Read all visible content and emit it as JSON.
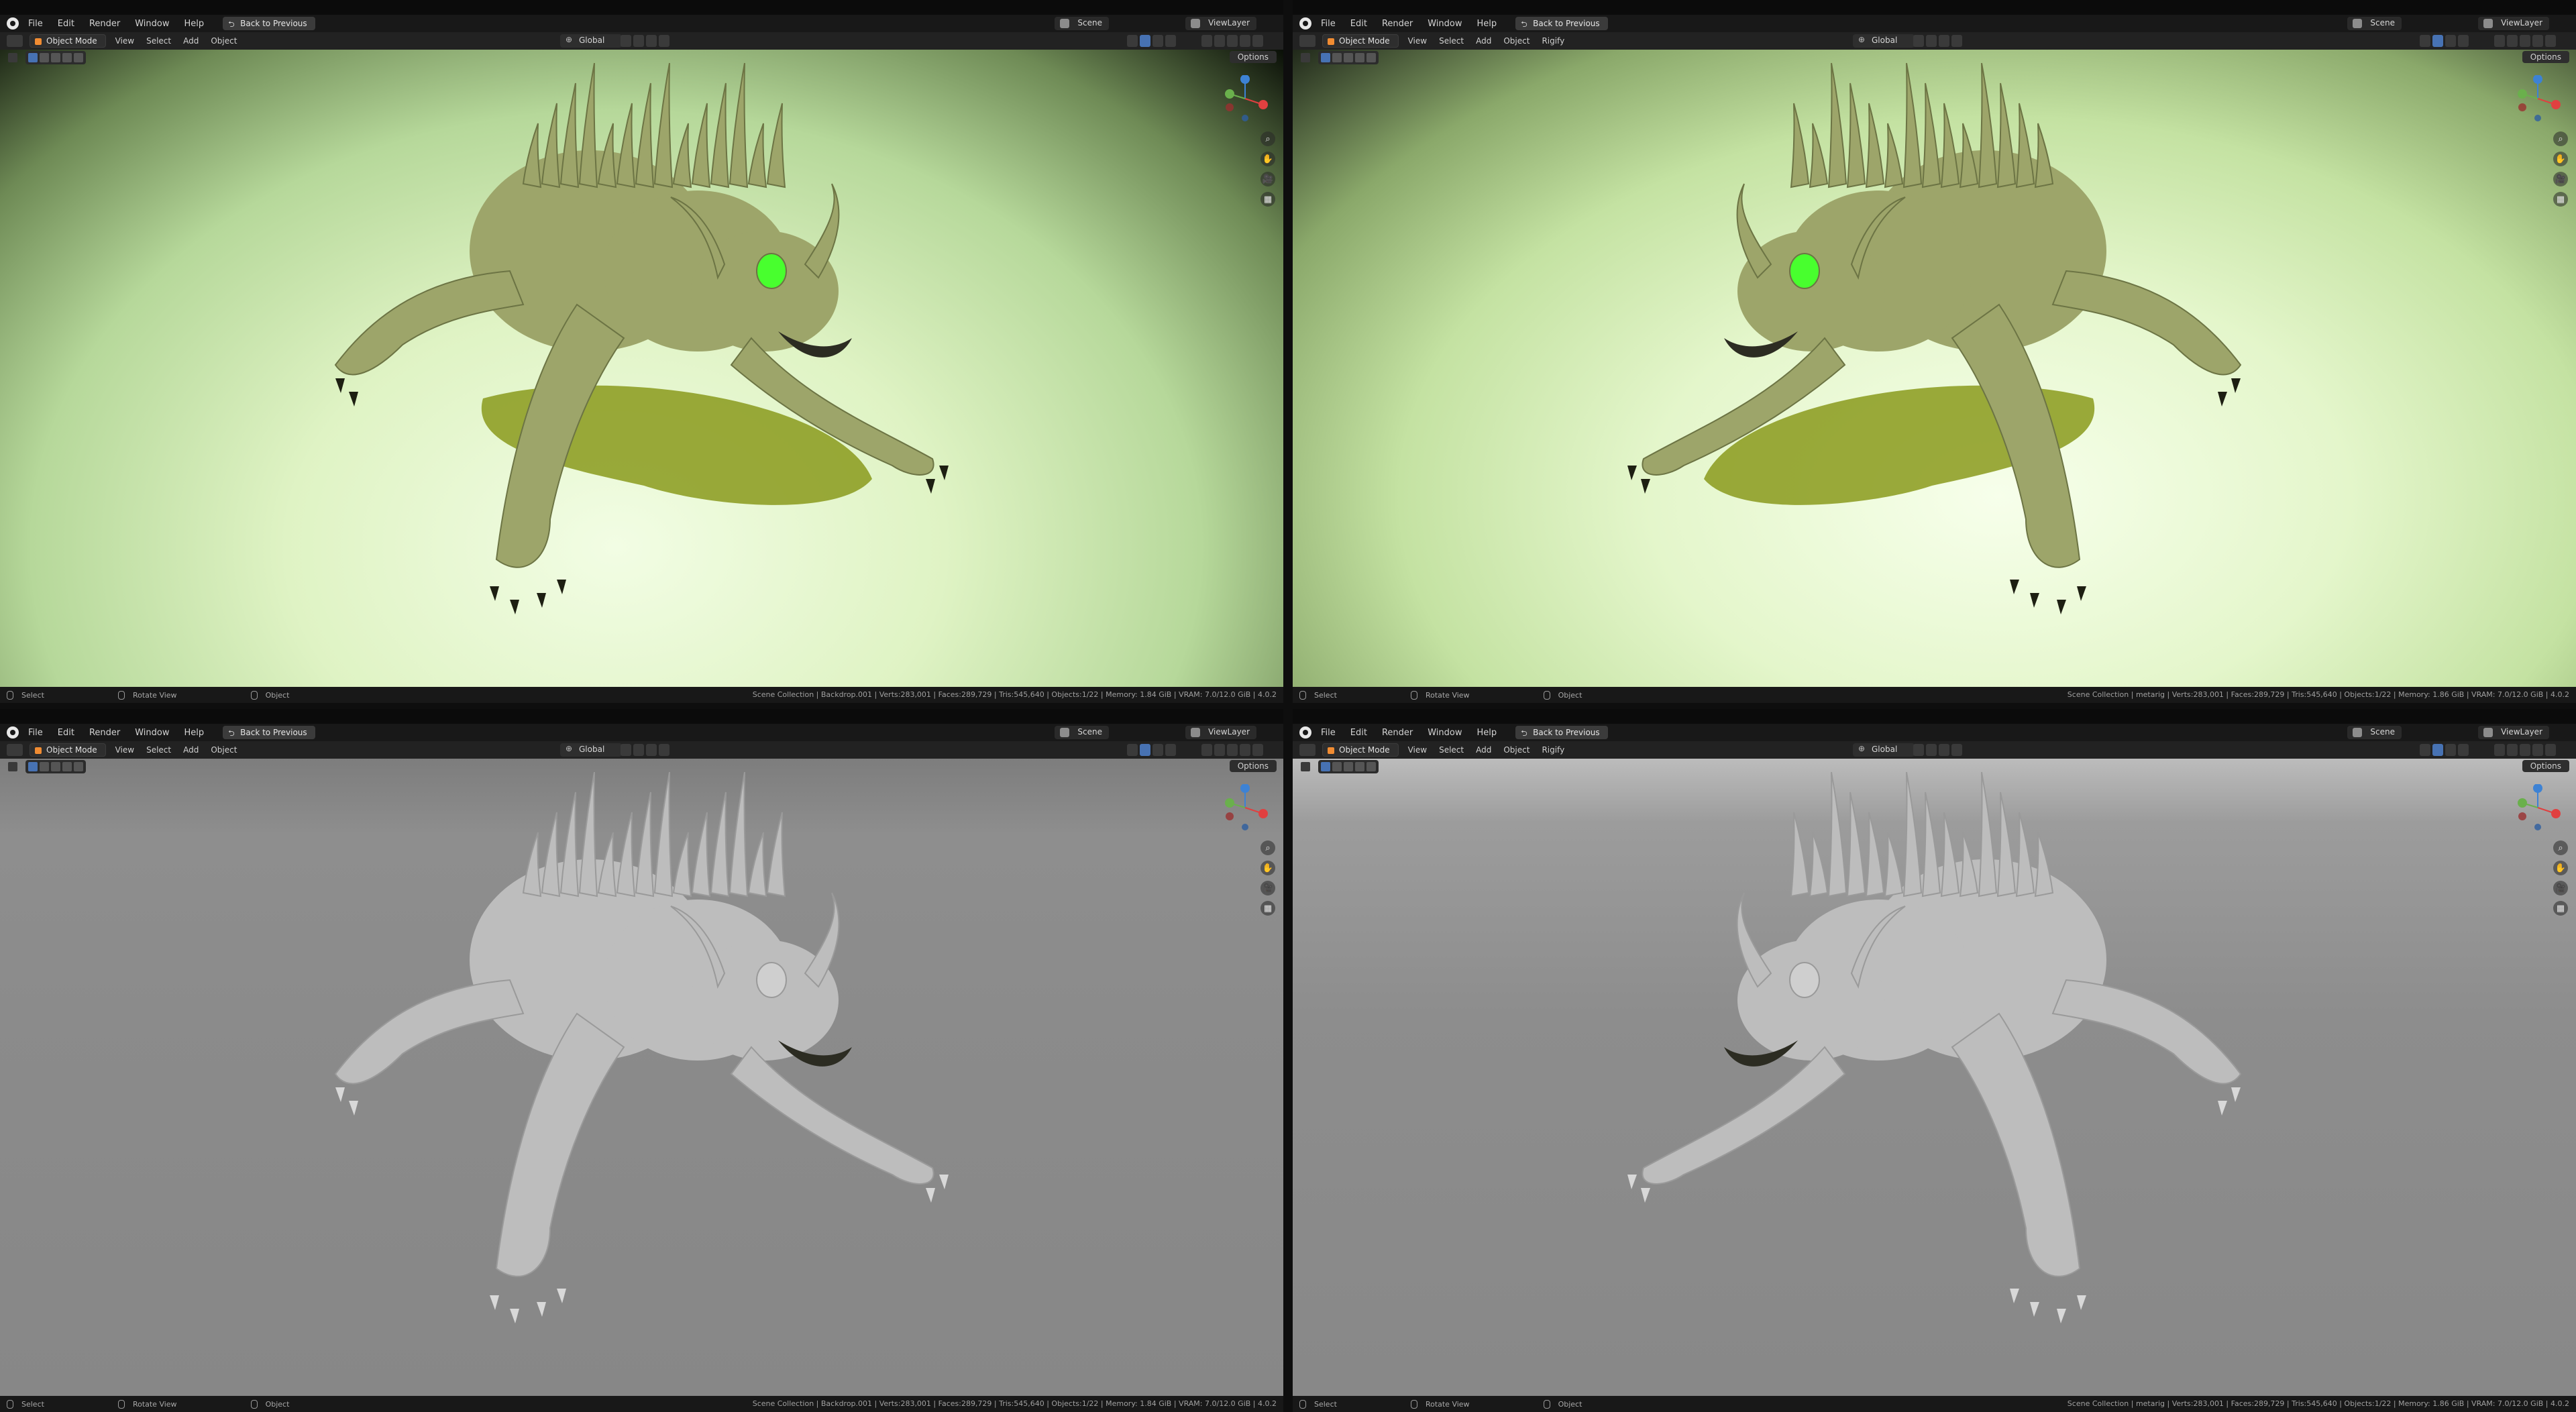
{
  "menu": {
    "file": "File",
    "edit": "Edit",
    "render": "Render",
    "window": "Window",
    "help": "Help",
    "back": "Back to Previous"
  },
  "scene": "Scene",
  "view_layer": "ViewLayer",
  "header": {
    "mode": "Object Mode",
    "view": "View",
    "select": "Select",
    "add": "Add",
    "object": "Object",
    "rigify": "Rigify",
    "orientation": "Global",
    "options": "Options"
  },
  "status": {
    "select": "Select",
    "rotate": "Rotate View",
    "object": "Object"
  },
  "stats_backdrop": "Scene Collection | Backdrop.001 | Verts:283,001 | Faces:289,729 | Tris:545,640 | Objects:1/22 | Memory: 1.84 GiB | VRAM: 7.0/12.0 GiB | 4.0.2",
  "stats_metarig": "Scene Collection | metarig | Verts:283,001 | Faces:289,729 | Tris:545,640 | Objects:1/22 | Memory: 1.86 GiB | VRAM: 7.0/12.0 GiB | 4.0.2",
  "nav": {
    "zoom": "⌕",
    "pan": "✋",
    "camera": "🎥",
    "grid": "▦"
  },
  "icons": [
    "blender-logo",
    "zoom-icon",
    "pan-icon",
    "camera-icon",
    "grid-icon",
    "mouse-icon"
  ],
  "colors": {
    "accent": "#4772b3",
    "object_mode": "#f18c32",
    "gizmo_x": "#e04040",
    "gizmo_y": "#6ab04c",
    "gizmo_z": "#3d82d4",
    "creature_lit": "#9da56a",
    "creature_clay": "#bdbdbd",
    "eye_glow": "#48ff2e"
  }
}
